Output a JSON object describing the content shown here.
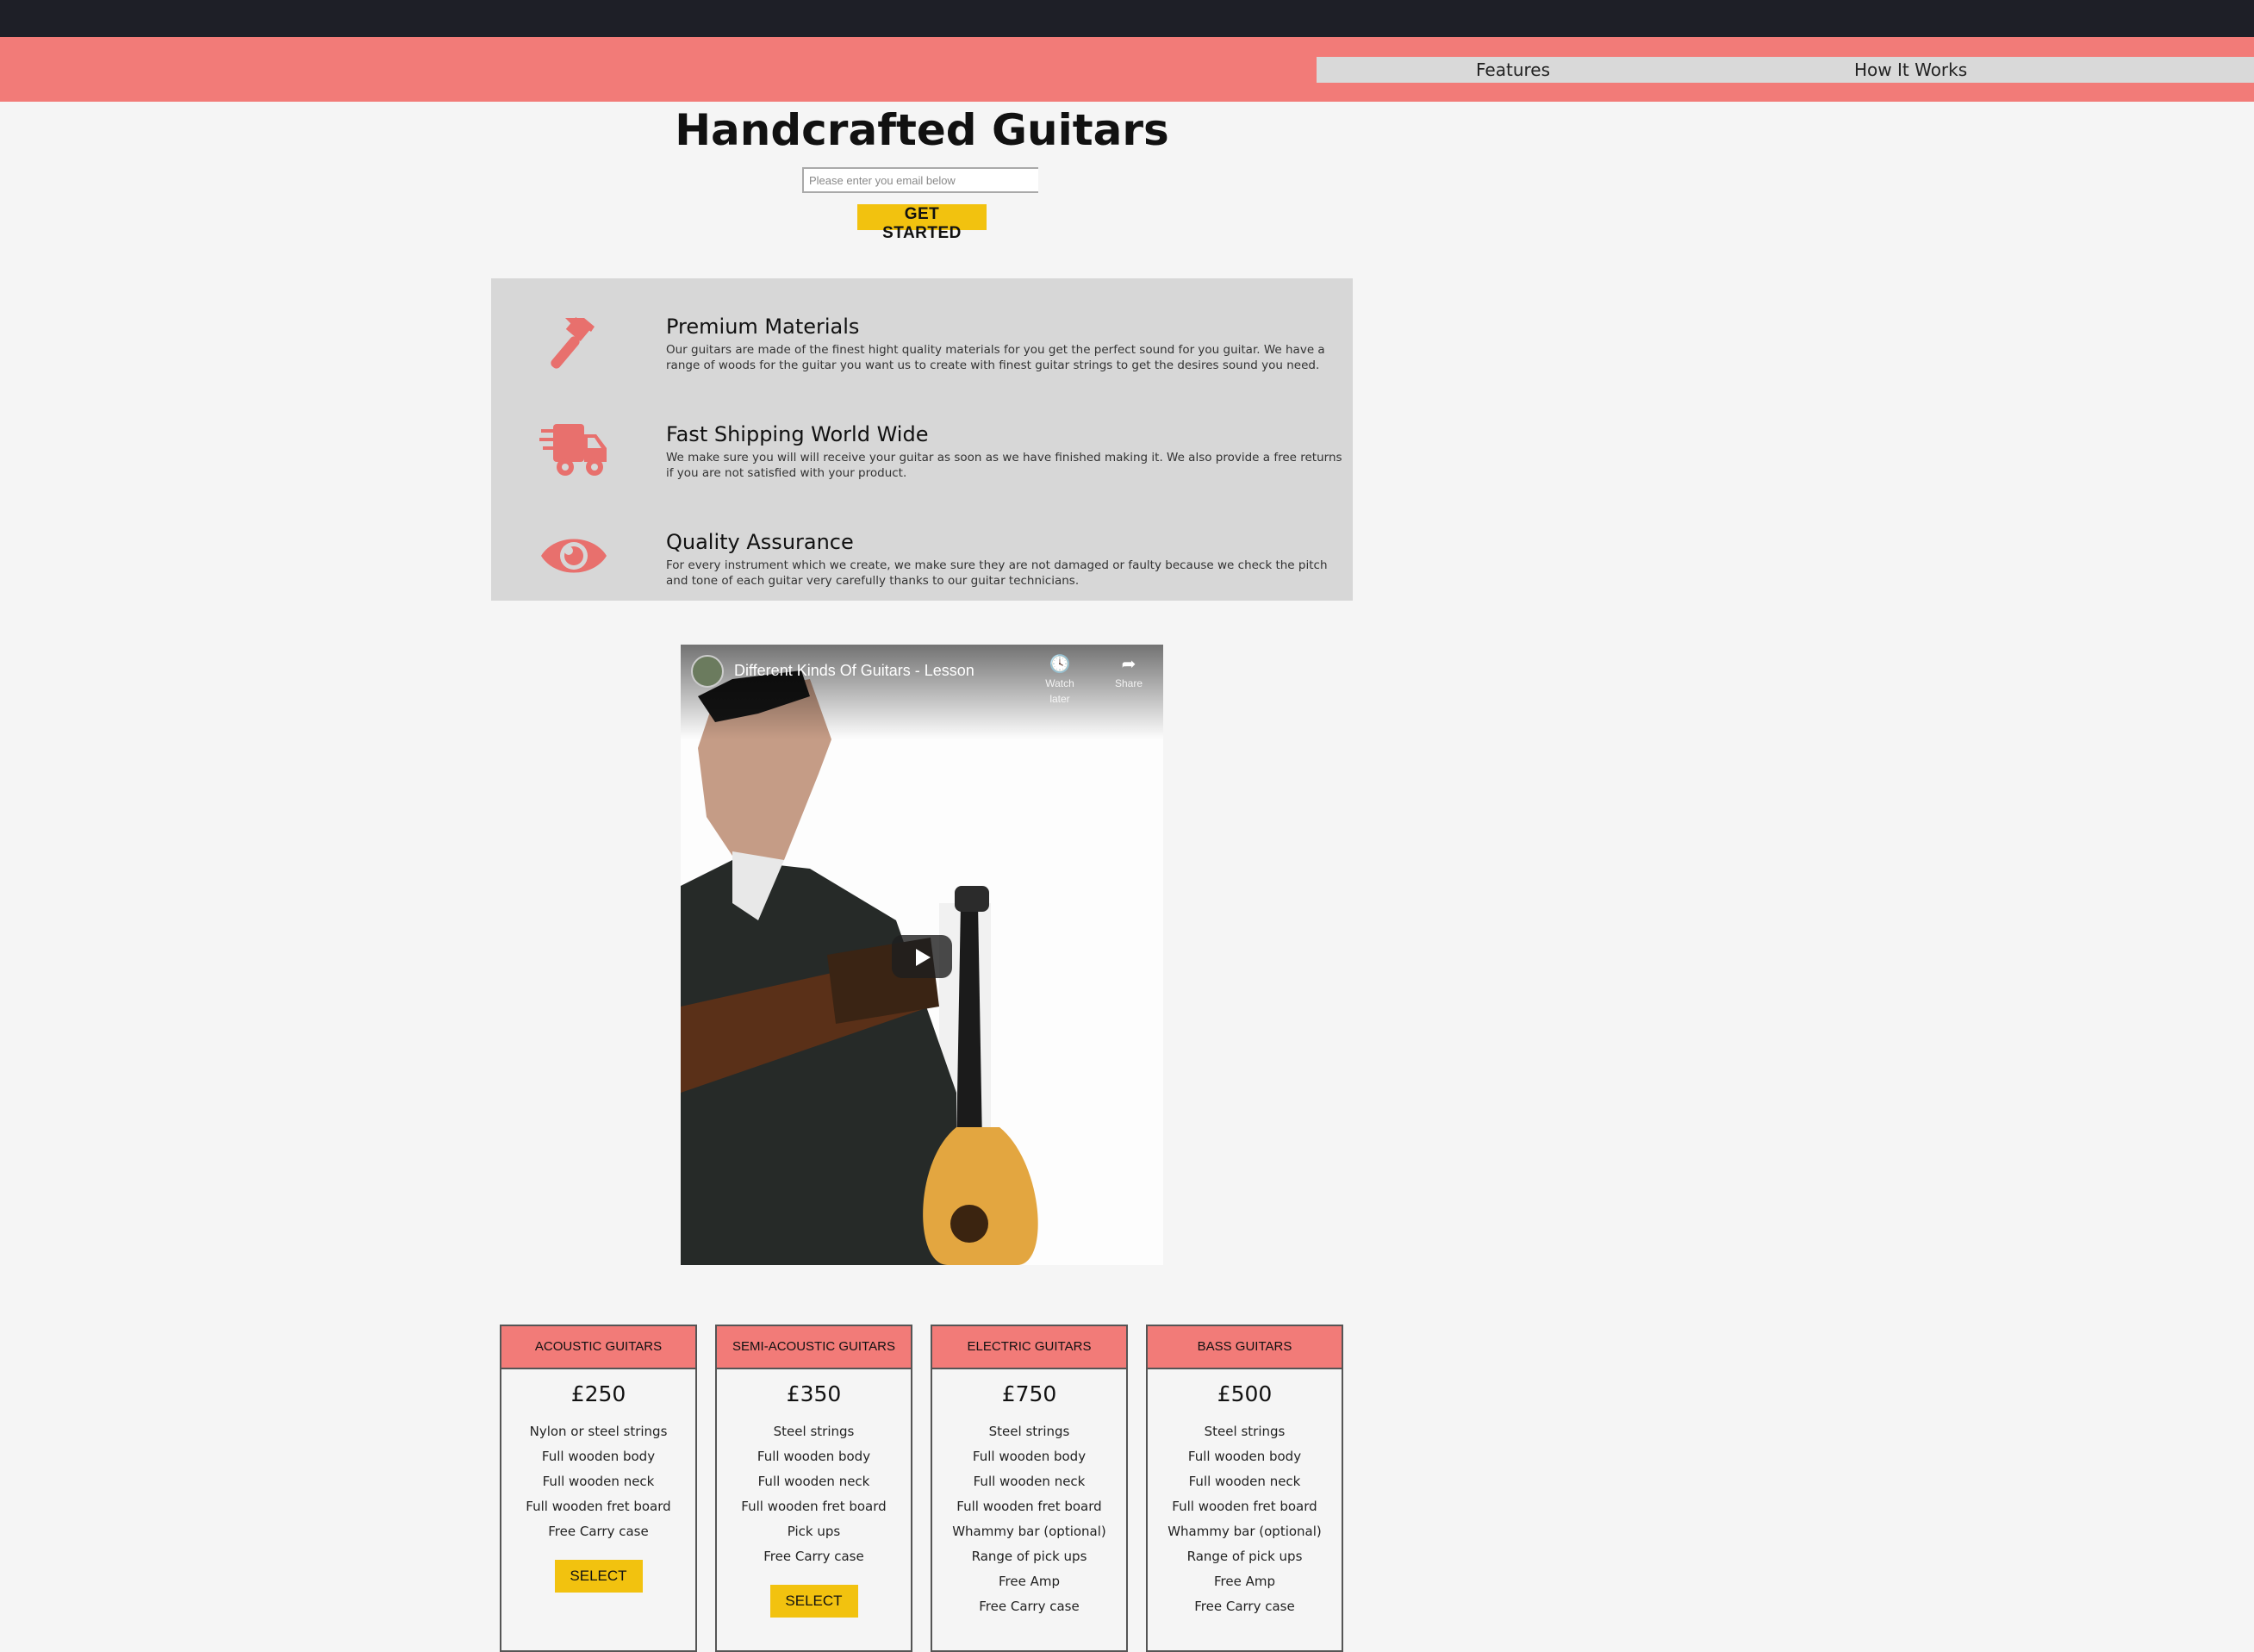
{
  "nav": {
    "features": "Features",
    "how_it_works": "How It Works"
  },
  "hero": {
    "title": "Handcrafted Guitars",
    "email_placeholder": "Please enter you email below",
    "cta": "GET STARTED"
  },
  "features": [
    {
      "icon": "hammer-icon",
      "title": "Premium Materials",
      "text": "Our guitars are made of the finest hight quality materials for you get the perfect sound for you guitar. We have a range of woods for the guitar you want us to create with finest guitar strings to get the desires sound you need."
    },
    {
      "icon": "shipping-truck-icon",
      "title": "Fast Shipping World Wide",
      "text": "We make sure you will will receive your guitar as soon as we have finished making it. We also provide a free returns if you are not satisfied with your product."
    },
    {
      "icon": "eye-icon",
      "title": "Quality Assurance",
      "text": "For every instrument which we create, we make sure they are not damaged or faulty because we check the pitch and tone of each guitar very carefully thanks to our guitar technicians."
    }
  ],
  "video": {
    "title": "Different Kinds Of Guitars - Lesson",
    "watch_later": "Watch later",
    "share": "Share"
  },
  "pricing": [
    {
      "name": "ACOUSTIC GUITARS",
      "price": "£250",
      "items": [
        "Nylon or steel strings",
        "Full wooden body",
        "Full wooden neck",
        "Full wooden fret board",
        "Free Carry case"
      ],
      "button": "SELECT"
    },
    {
      "name": "SEMI-ACOUSTIC GUITARS",
      "price": "£350",
      "items": [
        "Steel strings",
        "Full wooden body",
        "Full wooden neck",
        "Full wooden fret board",
        "Pick ups",
        "Free Carry case"
      ],
      "button": "SELECT"
    },
    {
      "name": "ELECTRIC GUITARS",
      "price": "£750",
      "items": [
        "Steel strings",
        "Full wooden body",
        "Full wooden neck",
        "Full wooden fret board",
        "Whammy bar (optional)",
        "Range of pick ups",
        "Free Amp",
        "Free Carry case"
      ]
    },
    {
      "name": "BASS GUITARS",
      "price": "£500",
      "items": [
        "Steel strings",
        "Full wooden body",
        "Full wooden neck",
        "Full wooden fret board",
        "Whammy bar (optional)",
        "Range of pick ups",
        "Free Amp",
        "Free Carry case"
      ]
    }
  ],
  "colors": {
    "accent": "#f27b78",
    "button": "#f2c20f",
    "topbar": "#1e1f27",
    "panel": "#d7d7d7"
  }
}
